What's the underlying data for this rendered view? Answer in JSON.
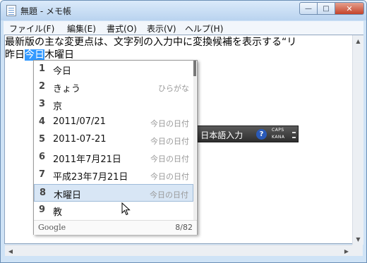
{
  "window": {
    "title": "無題 - メモ帳",
    "minimize_glyph": "—",
    "maximize_glyph": "□",
    "close_glyph": "✕"
  },
  "menu": [
    {
      "label": "ファイル(F)"
    },
    {
      "label": "編集(E)"
    },
    {
      "label": "書式(O)"
    },
    {
      "label": "表示(V)"
    },
    {
      "label": "ヘルプ(H)"
    }
  ],
  "document": {
    "line1": "最新版の主な変更点は、文字列の入力中に変換候補を表示する“リ",
    "line2_prefix": "昨日",
    "line2_selected": "今日",
    "line2_converting": "木曜日"
  },
  "ime_toolbar": {
    "label": "e 日本語入力",
    "help_glyph": "?",
    "caps": "CAPS",
    "kana": "KANA"
  },
  "candidates": {
    "items": [
      {
        "num": "1",
        "text": "今日",
        "annotation": ""
      },
      {
        "num": "2",
        "text": "きょう",
        "annotation": "ひらがな"
      },
      {
        "num": "3",
        "text": "京",
        "annotation": ""
      },
      {
        "num": "4",
        "text": "2011/07/21",
        "annotation": "今日の日付"
      },
      {
        "num": "5",
        "text": "2011-07-21",
        "annotation": "今日の日付"
      },
      {
        "num": "6",
        "text": "2011年7月21日",
        "annotation": "今日の日付"
      },
      {
        "num": "7",
        "text": "平成23年7月21日",
        "annotation": "今日の日付"
      },
      {
        "num": "8",
        "text": "木曜日",
        "annotation": "今日の日付"
      },
      {
        "num": "9",
        "text": "教",
        "annotation": ""
      }
    ],
    "selected_index": 8,
    "footer_brand": "Google",
    "page_indicator": "8/82"
  },
  "scrollbar_glyphs": {
    "up": "▲",
    "down": "▼",
    "left": "◀",
    "right": "▶"
  },
  "colors": {
    "selection": "#3399ff",
    "close_button": "#c4432a",
    "candidate_highlight": "#d8e6f5"
  }
}
